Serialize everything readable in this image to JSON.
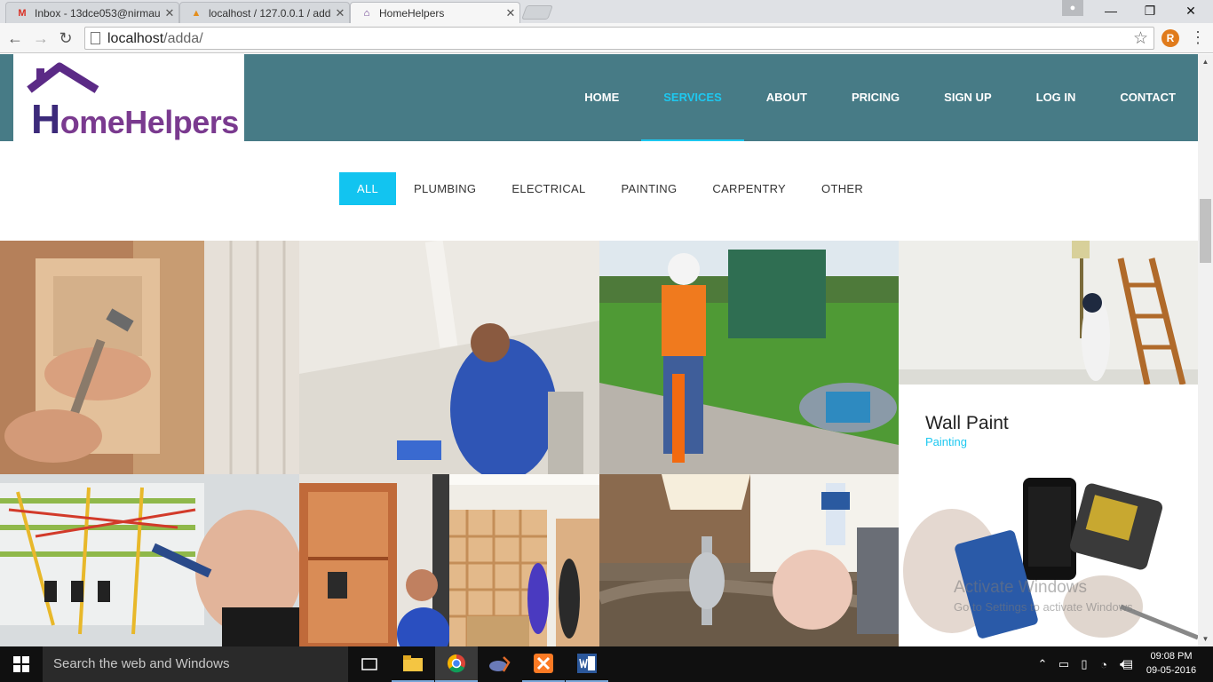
{
  "browser": {
    "tabs": [
      {
        "title": "Inbox - 13dce053@nirmau",
        "icon": "gmail-icon"
      },
      {
        "title": "localhost / 127.0.0.1 / add",
        "icon": "phpmyadmin-icon"
      },
      {
        "title": "HomeHelpers",
        "icon": "homehelpers-icon"
      }
    ],
    "url_host": "localhost",
    "url_path": "/adda/"
  },
  "site": {
    "logo_initial": "H",
    "logo_rest": "omeHelpers",
    "nav": [
      "HOME",
      "SERVICES",
      "ABOUT",
      "PRICING",
      "SIGN UP",
      "LOG IN",
      "CONTACT"
    ],
    "active_nav": "SERVICES",
    "filters": [
      "ALL",
      "PLUMBING",
      "ELECTRICAL",
      "PAINTING",
      "CARPENTRY",
      "OTHER"
    ],
    "active_filter": "ALL",
    "caption": {
      "title": "Wall Paint",
      "category": "Painting"
    },
    "watermark": {
      "line1": "Activate Windows",
      "line2": "Go to Settings to activate Windows."
    },
    "accent_color": "#1ec8f0",
    "header_color": "#477b86"
  },
  "gallery": [
    {
      "name": "carpentry-door-hammer-photo"
    },
    {
      "name": "electrician-ceiling-light-photo"
    },
    {
      "name": "cable-locator-worker-photo"
    },
    {
      "name": "wall-painter-ladder-photo"
    },
    {
      "name": "electrical-panel-screwdriver-photo"
    },
    {
      "name": "cabinet-drill-photo"
    },
    {
      "name": "shelf-installers-photo"
    },
    {
      "name": "kitchen-faucet-repair-photo"
    },
    {
      "name": "phone-repair-photo"
    }
  ],
  "taskbar": {
    "search_placeholder": "Search the web and Windows",
    "time": "09:08 PM",
    "date": "09-05-2016"
  }
}
